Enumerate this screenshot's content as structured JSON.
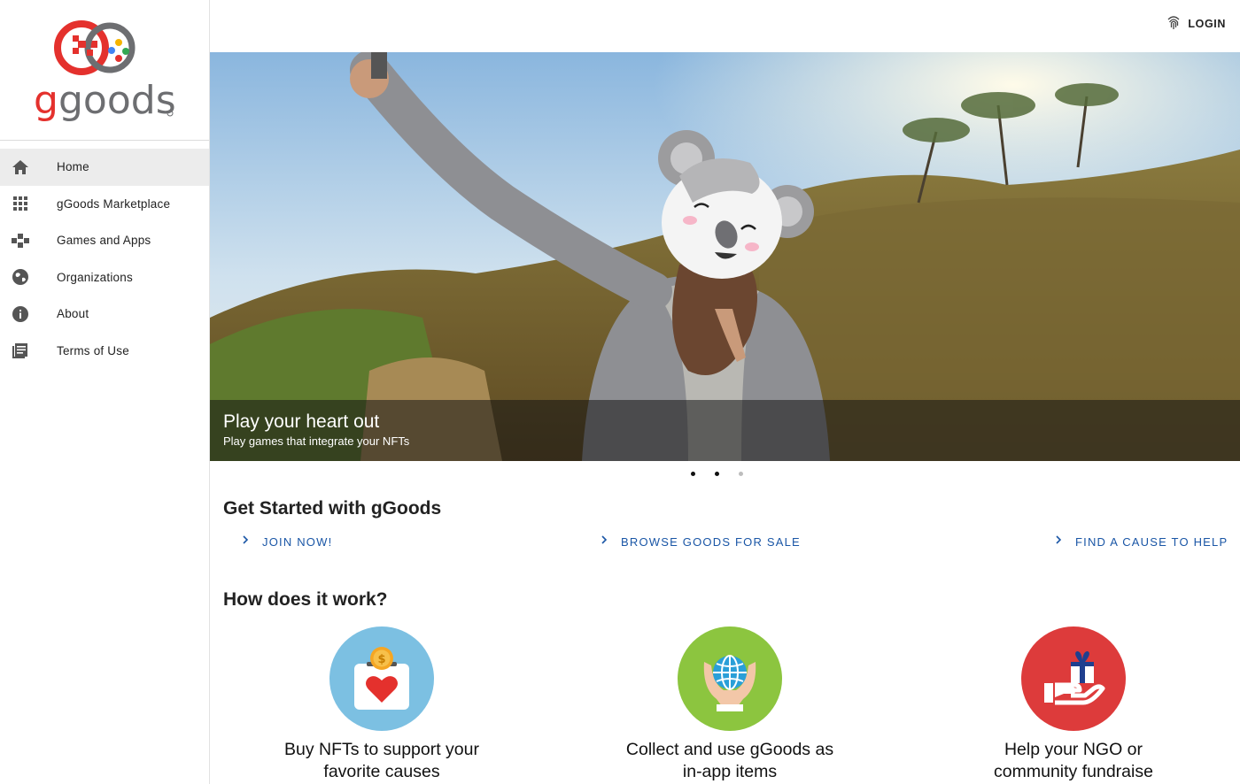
{
  "brand": {
    "name": "ggoods",
    "colors": {
      "red": "#e4312d",
      "gray": "#6d6e71",
      "blue": "#1a56a6"
    }
  },
  "header": {
    "login_label": "LOGIN",
    "login_icon": "fingerprint-icon"
  },
  "sidebar": {
    "items": [
      {
        "label": "Home",
        "icon": "home-icon",
        "active": true
      },
      {
        "label": "gGoods Marketplace",
        "icon": "grid-icon",
        "active": false
      },
      {
        "label": "Games and Apps",
        "icon": "gamepad-icon",
        "active": false
      },
      {
        "label": "Organizations",
        "icon": "globe-icon",
        "active": false
      },
      {
        "label": "About",
        "icon": "info-icon",
        "active": false
      },
      {
        "label": "Terms of Use",
        "icon": "document-icon",
        "active": false
      }
    ]
  },
  "hero": {
    "title": "Play your heart out",
    "subtitle": "Play games that integrate your NFTs",
    "slides": 3,
    "active_slide": 1
  },
  "get_started": {
    "heading": "Get Started with gGoods",
    "links": [
      {
        "label": "JOIN NOW!"
      },
      {
        "label": "BROWSE GOODS FOR SALE"
      },
      {
        "label": "FIND A CAUSE TO HELP"
      }
    ]
  },
  "how_it_works": {
    "heading": "How does it work?",
    "features": [
      {
        "line1": "Buy NFTs to support your",
        "line2": "favorite causes",
        "icon": "donation-box-icon",
        "color": "#7cc0e2"
      },
      {
        "line1": "Collect and use gGoods as",
        "line2": "in-app items",
        "icon": "globe-in-hands-icon",
        "color": "#8cc53f"
      },
      {
        "line1": "Help your NGO or",
        "line2": "community fundraise",
        "icon": "gift-in-hand-icon",
        "color": "#dd3b3b"
      }
    ]
  }
}
